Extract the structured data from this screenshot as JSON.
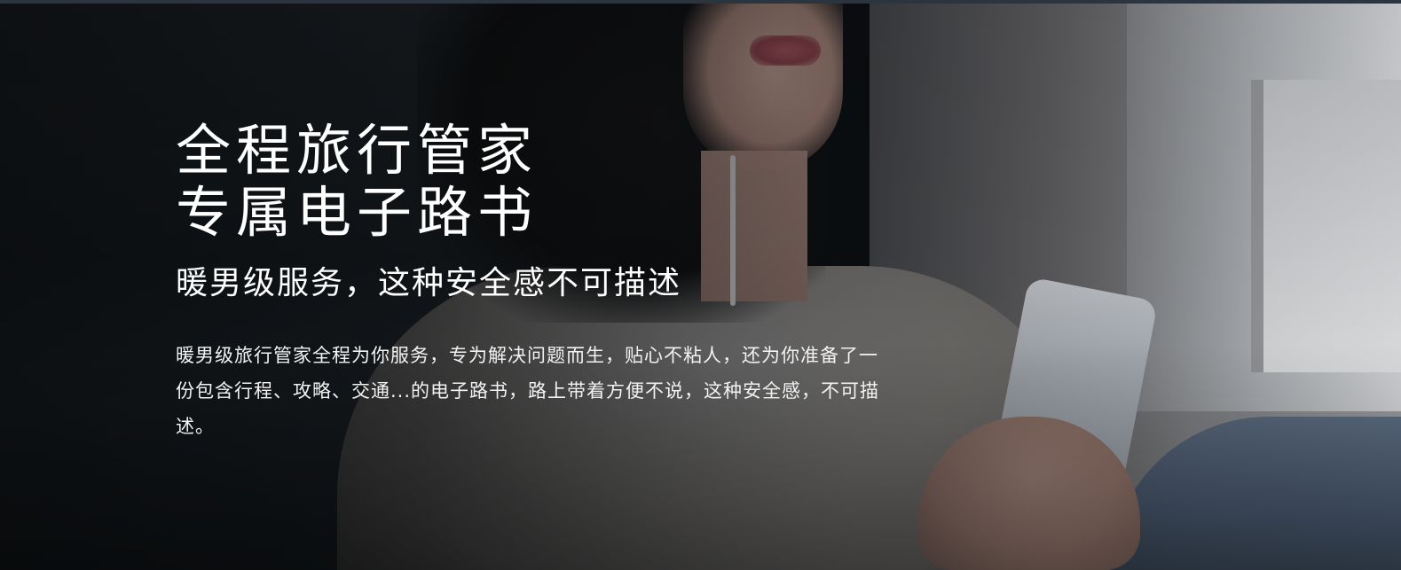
{
  "hero": {
    "headline_line1": "全程旅行管家",
    "headline_line2": "专属电子路书",
    "subheadline": "暖男级服务，这种安全感不可描述",
    "description": "暖男级旅行管家全程为你服务，专为解决问题而生，贴心不粘人，还为你准备了一份包含行程、攻略、交通...的电子路书，路上带着方便不说，这种安全感，不可描述。"
  },
  "colors": {
    "text": "#ffffff",
    "overlay": "#06080a"
  }
}
